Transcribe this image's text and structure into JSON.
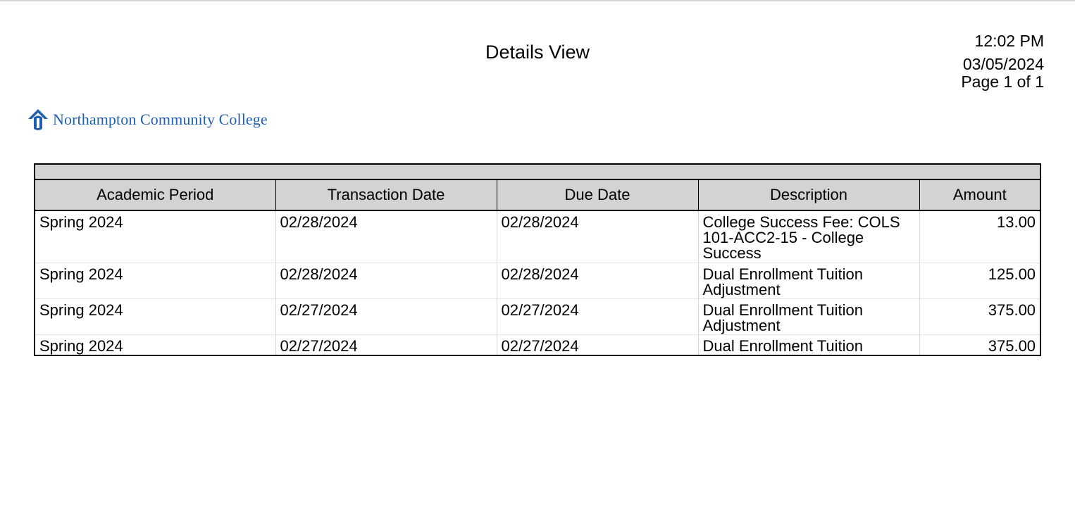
{
  "report": {
    "title": "Details View",
    "time": "12:02 PM",
    "date": "03/05/2024",
    "page": "Page 1 of 1"
  },
  "logo": {
    "name": "Northampton Community College",
    "icon": "ncc-logo-icon",
    "color": "#1f5fb0"
  },
  "table": {
    "columns": [
      "Academic Period",
      "Transaction Date",
      "Due Date",
      "Description",
      "Amount"
    ],
    "rows": [
      [
        "Spring 2024",
        "02/28/2024",
        "02/28/2024",
        "College Success Fee: COLS 101-ACC2-15 - College Success",
        "13.00"
      ],
      [
        "Spring 2024",
        "02/28/2024",
        "02/28/2024",
        "Dual Enrollment Tuition Adjustment",
        "125.00"
      ],
      [
        "Spring 2024",
        "02/27/2024",
        "02/27/2024",
        "Dual Enrollment Tuition Adjustment",
        "375.00"
      ],
      [
        "Spring 2024",
        "02/27/2024",
        "02/27/2024",
        "Dual Enrollment Tuition",
        "375.00"
      ]
    ]
  }
}
